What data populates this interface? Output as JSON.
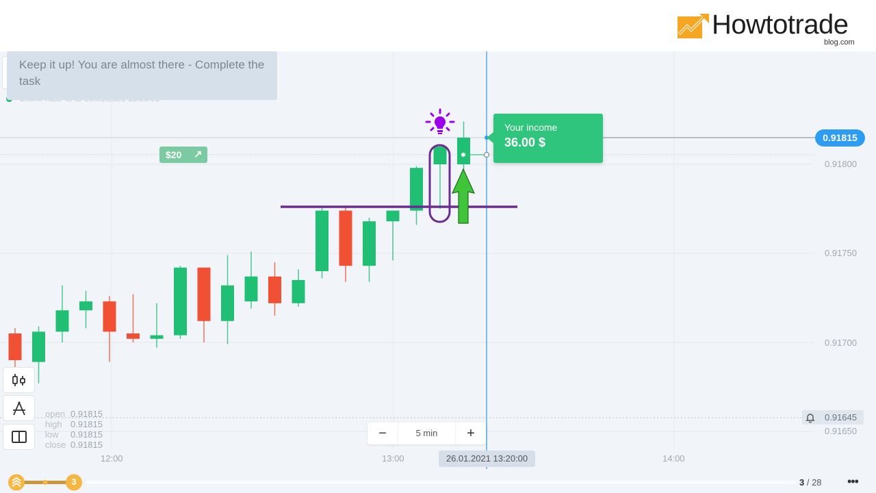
{
  "brand": {
    "logo_text": "Howtotrade",
    "logo_sub": "blog.com",
    "icon": "rising-chart-logo-icon",
    "color": "#f5a623"
  },
  "toast": {
    "message": "Keep it up! You are almost there - Complete the task"
  },
  "status": {
    "text": "Online NZD-CAD 26.01.2021 13:20:01",
    "dot_color": "#1fbf73"
  },
  "price_axis": {
    "current_price": "0.91815",
    "labels": [
      "0.91800",
      "0.91750",
      "0.91700",
      "0.91650"
    ],
    "alert_value": "0.91645",
    "alert_icon": "bell-icon"
  },
  "bet": {
    "amount": "$20",
    "direction_icon": "arrow-up-right-icon"
  },
  "income": {
    "label": "Your income",
    "value": "36.00 $"
  },
  "tools": [
    {
      "name": "candles-chart-type",
      "icon": "candlestick-icon"
    },
    {
      "name": "drawing-tools",
      "icon": "compass-icon"
    },
    {
      "name": "split-layout",
      "icon": "split-view-icon"
    }
  ],
  "ohlc": [
    {
      "key": "open",
      "value": "0.91815"
    },
    {
      "key": "high",
      "value": "0.91815"
    },
    {
      "key": "low",
      "value": "0.91815"
    },
    {
      "key": "close",
      "value": "0.91815"
    }
  ],
  "zoom": {
    "minus_label": "−",
    "value": "5 min",
    "plus_label": "+"
  },
  "time_axis": {
    "labels": [
      "12:00",
      "13:00",
      "14:00"
    ],
    "cursor_time": "26.01.2021 13:20:00"
  },
  "progress": {
    "level": "3",
    "page": "3",
    "total": "28",
    "more_label": "•••"
  },
  "chart_data": {
    "type": "candlestick",
    "title": "NZD-CAD",
    "interval": "5 min",
    "ylim": [
      0.9164,
      0.9185
    ],
    "colors": {
      "up": "#21bf73",
      "down": "#f05033"
    },
    "candles": [
      {
        "o": 0.91705,
        "h": 0.91708,
        "l": 0.9168,
        "c": 0.9169
      },
      {
        "o": 0.91689,
        "h": 0.91709,
        "l": 0.91677,
        "c": 0.91706
      },
      {
        "o": 0.91706,
        "h": 0.91732,
        "l": 0.917,
        "c": 0.91718
      },
      {
        "o": 0.91718,
        "h": 0.91729,
        "l": 0.91708,
        "c": 0.91723
      },
      {
        "o": 0.91723,
        "h": 0.91726,
        "l": 0.91689,
        "c": 0.91706
      },
      {
        "o": 0.91705,
        "h": 0.91727,
        "l": 0.917,
        "c": 0.91702
      },
      {
        "o": 0.91702,
        "h": 0.91722,
        "l": 0.91697,
        "c": 0.91704
      },
      {
        "o": 0.91704,
        "h": 0.91743,
        "l": 0.91702,
        "c": 0.91742
      },
      {
        "o": 0.91742,
        "h": 0.91742,
        "l": 0.917,
        "c": 0.91712
      },
      {
        "o": 0.91712,
        "h": 0.91749,
        "l": 0.91699,
        "c": 0.91732
      },
      {
        "o": 0.91723,
        "h": 0.91751,
        "l": 0.91719,
        "c": 0.91737
      },
      {
        "o": 0.91737,
        "h": 0.91745,
        "l": 0.91715,
        "c": 0.91722
      },
      {
        "o": 0.91722,
        "h": 0.91741,
        "l": 0.9172,
        "c": 0.91735
      },
      {
        "o": 0.9174,
        "h": 0.91776,
        "l": 0.91736,
        "c": 0.91774
      },
      {
        "o": 0.91774,
        "h": 0.91777,
        "l": 0.91734,
        "c": 0.91743
      },
      {
        "o": 0.91743,
        "h": 0.9177,
        "l": 0.91734,
        "c": 0.91768
      },
      {
        "o": 0.91768,
        "h": 0.91774,
        "l": 0.91746,
        "c": 0.91774
      },
      {
        "o": 0.91774,
        "h": 0.91799,
        "l": 0.91766,
        "c": 0.91798
      },
      {
        "o": 0.918,
        "h": 0.91811,
        "l": 0.91775,
        "c": 0.9181
      },
      {
        "o": 0.918,
        "h": 0.91824,
        "l": 0.91792,
        "c": 0.91815
      }
    ],
    "annotations": {
      "resistance_level": 0.91776,
      "entry_price": 0.918,
      "current_price": 0.91815,
      "alert_level": 0.91645,
      "highlighted_candle_index": 18,
      "arrow": "up",
      "hint_icon": "lightbulb-icon"
    },
    "x_ticks": [
      "12:00",
      "13:00",
      "14:00"
    ],
    "y_ticks": [
      "0.91800",
      "0.91750",
      "0.91700",
      "0.91650"
    ]
  }
}
